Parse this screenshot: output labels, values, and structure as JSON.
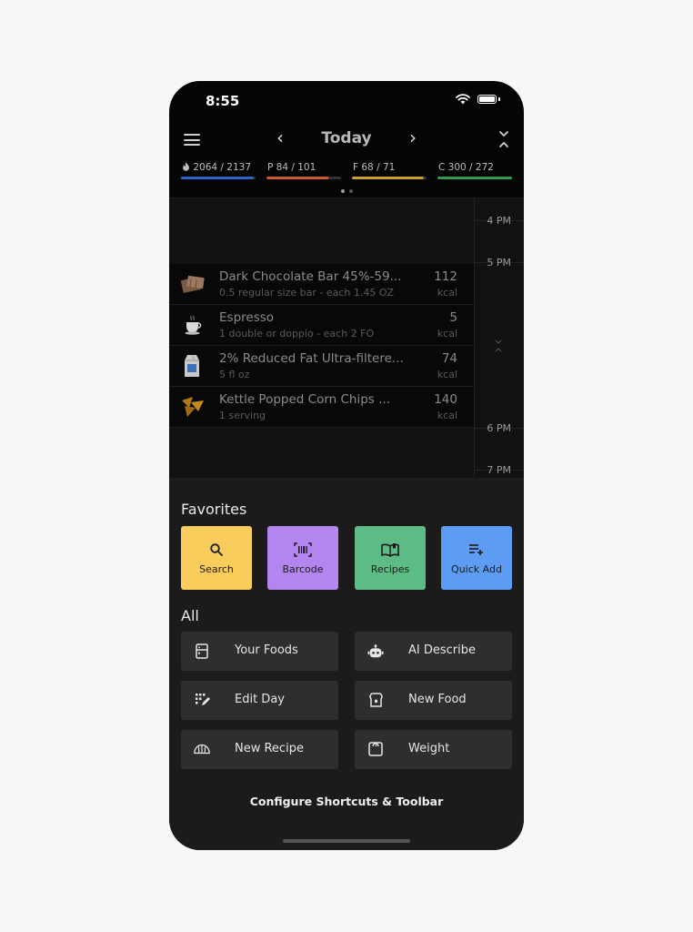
{
  "status": {
    "time": "8:55"
  },
  "header": {
    "title": "Today",
    "prev": "‹",
    "next": "›"
  },
  "macros": [
    {
      "label": "2064 / 2137",
      "color": "#2f63c8",
      "progress": 0.97,
      "icon": "flame-icon"
    },
    {
      "label": "P 84 / 101",
      "color": "#c95a2f",
      "progress": 0.83
    },
    {
      "label": "F 68 / 71",
      "color": "#c9a22a",
      "progress": 0.96
    },
    {
      "label": "C 300 / 272",
      "color": "#2f9a52",
      "progress": 1.0
    }
  ],
  "timeline": {
    "times": [
      "4 PM",
      "5 PM",
      "6 PM",
      "7 PM"
    ],
    "foods": [
      {
        "name": "Dark Chocolate Bar 45%-59...",
        "desc": "0.5 regular size bar - each 1.45 OZ",
        "kcal": "112",
        "unit": "kcal",
        "icon": "chocolate-icon"
      },
      {
        "name": "Espresso",
        "desc": "1 double or doppio - each 2 FO",
        "kcal": "5",
        "unit": "kcal",
        "icon": "coffee-cup-icon"
      },
      {
        "name": "2% Reduced Fat Ultra-filtere...",
        "desc": "5 fl oz",
        "kcal": "74",
        "unit": "kcal",
        "icon": "milk-carton-icon"
      },
      {
        "name": "Kettle Popped Corn Chips ...",
        "desc": "1 serving",
        "kcal": "140",
        "unit": "kcal",
        "icon": "chips-icon"
      }
    ]
  },
  "sheet": {
    "favorites_title": "Favorites",
    "favorites": [
      {
        "label": "Search",
        "color": "#f9cd5b",
        "icon": "search-icon"
      },
      {
        "label": "Barcode",
        "color": "#b386ef",
        "icon": "barcode-icon"
      },
      {
        "label": "Recipes",
        "color": "#5dbb85",
        "icon": "book-icon"
      },
      {
        "label": "Quick Add",
        "color": "#5c9cf2",
        "icon": "list-add-icon"
      }
    ],
    "all_title": "All",
    "all": [
      {
        "label": "Your Foods",
        "icon": "fridge-icon"
      },
      {
        "label": "AI Describe",
        "icon": "robot-icon"
      },
      {
        "label": "Edit Day",
        "icon": "edit-grid-icon"
      },
      {
        "label": "New Food",
        "icon": "toast-icon"
      },
      {
        "label": "New Recipe",
        "icon": "croissant-icon"
      },
      {
        "label": "Weight",
        "icon": "scale-icon"
      }
    ],
    "configure": "Configure Shortcuts & Toolbar"
  }
}
